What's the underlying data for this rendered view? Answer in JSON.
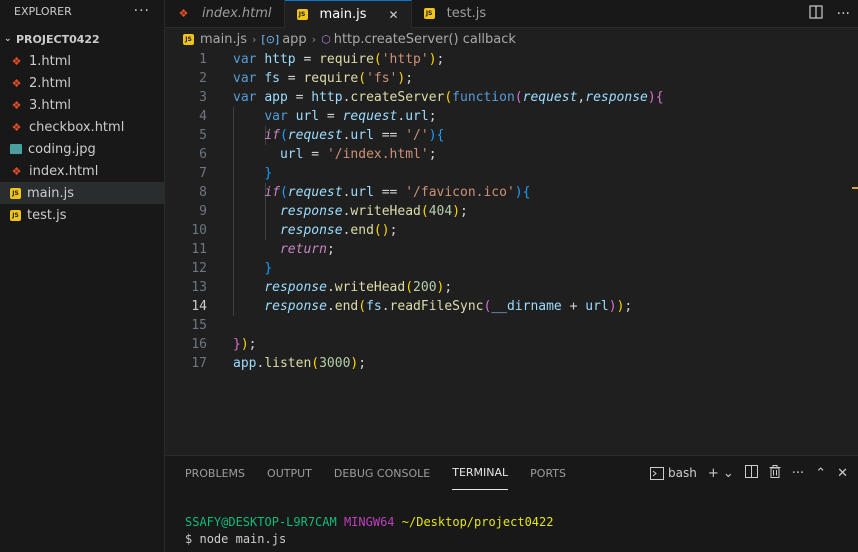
{
  "sidebar": {
    "title": "EXPLORER",
    "more": "···",
    "project": "PROJECT0422",
    "files": [
      {
        "name": "1.html",
        "type": "html"
      },
      {
        "name": "2.html",
        "type": "html"
      },
      {
        "name": "3.html",
        "type": "html"
      },
      {
        "name": "checkbox.html",
        "type": "html"
      },
      {
        "name": "coding.jpg",
        "type": "image"
      },
      {
        "name": "index.html",
        "type": "html"
      },
      {
        "name": "main.js",
        "type": "js"
      },
      {
        "name": "test.js",
        "type": "js"
      }
    ]
  },
  "tabs": [
    {
      "label": "index.html",
      "type": "html",
      "italic": true
    },
    {
      "label": "main.js",
      "type": "js",
      "active": true
    },
    {
      "label": "test.js",
      "type": "js"
    }
  ],
  "breadcrumb": {
    "file": "main.js",
    "symbol1": "app",
    "symbol2": "http.createServer() callback"
  },
  "code": {
    "line_numbers": [
      "1",
      "2",
      "3",
      "4",
      "5",
      "6",
      "7",
      "8",
      "9",
      "10",
      "11",
      "12",
      "13",
      "14",
      "15",
      "16",
      "17"
    ],
    "current_line": 14
  },
  "panel": {
    "tabs": [
      "PROBLEMS",
      "OUTPUT",
      "DEBUG CONSOLE",
      "TERMINAL",
      "PORTS"
    ],
    "active_tab": "TERMINAL",
    "shell": "bash",
    "terminal": {
      "user": "SSAFY@DESKTOP-L9R7CAM",
      "system": "MINGW64",
      "path": "~/Desktop/project0422",
      "prompt": "$",
      "command": "node main.js"
    }
  },
  "colors": {
    "accent": "#0078d4",
    "background": "#1f1f1f",
    "sidebar": "#181818"
  }
}
